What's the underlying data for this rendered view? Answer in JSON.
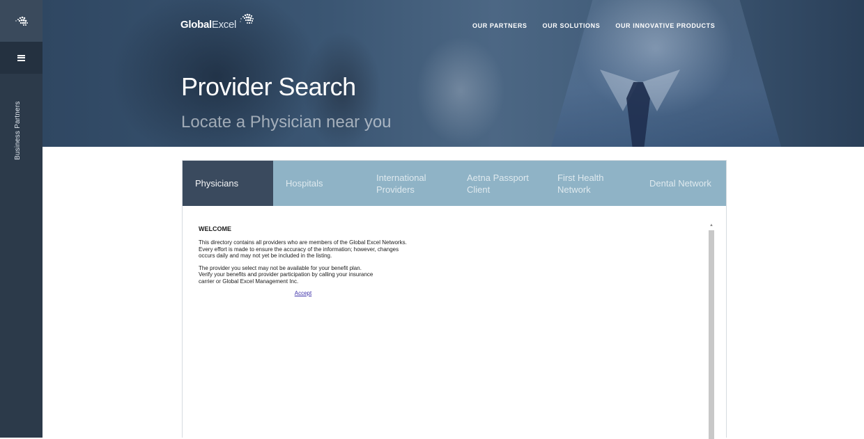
{
  "rail": {
    "vertical_label": "Business Partners"
  },
  "brand": {
    "bold": "Global",
    "light": "Excel"
  },
  "topnav": {
    "items": [
      {
        "label": "OUR PARTNERS"
      },
      {
        "label": "OUR SOLUTIONS"
      },
      {
        "label": "OUR INNOVATIVE PRODUCTS"
      }
    ]
  },
  "hero": {
    "title": "Provider Search",
    "subtitle": "Locate a Physician near you"
  },
  "tabs": [
    {
      "line1": "Physicians",
      "line2": ""
    },
    {
      "line1": "Hospitals",
      "line2": ""
    },
    {
      "line1": "International",
      "line2": "Providers"
    },
    {
      "line1": "Aetna Passport",
      "line2": "Client"
    },
    {
      "line1": "First Health",
      "line2": "Network"
    },
    {
      "line1": "Dental Network",
      "line2": ""
    }
  ],
  "welcome": {
    "heading": "WELCOME",
    "para1_l1": "This directory contains all providers who are members of the Global Excel Networks.",
    "para1_l2": "Every effort is made to ensure the accuracy of the information; however, changes",
    "para1_l3": "occurs daily and may not yet be included in the listing.",
    "para2_l1": "The provider you select may not be available for your benefit plan.",
    "para2_l2": "Verify your benefits and provider participation by calling your insurance",
    "para2_l3": "carrier or Global Excel Management Inc.",
    "accept": "Accept"
  },
  "colors": {
    "rail": "#2c3a4a",
    "tab_bar": "#8fb3c6",
    "tab_active": "#3a4a5e",
    "link": "#3b2fa8"
  }
}
